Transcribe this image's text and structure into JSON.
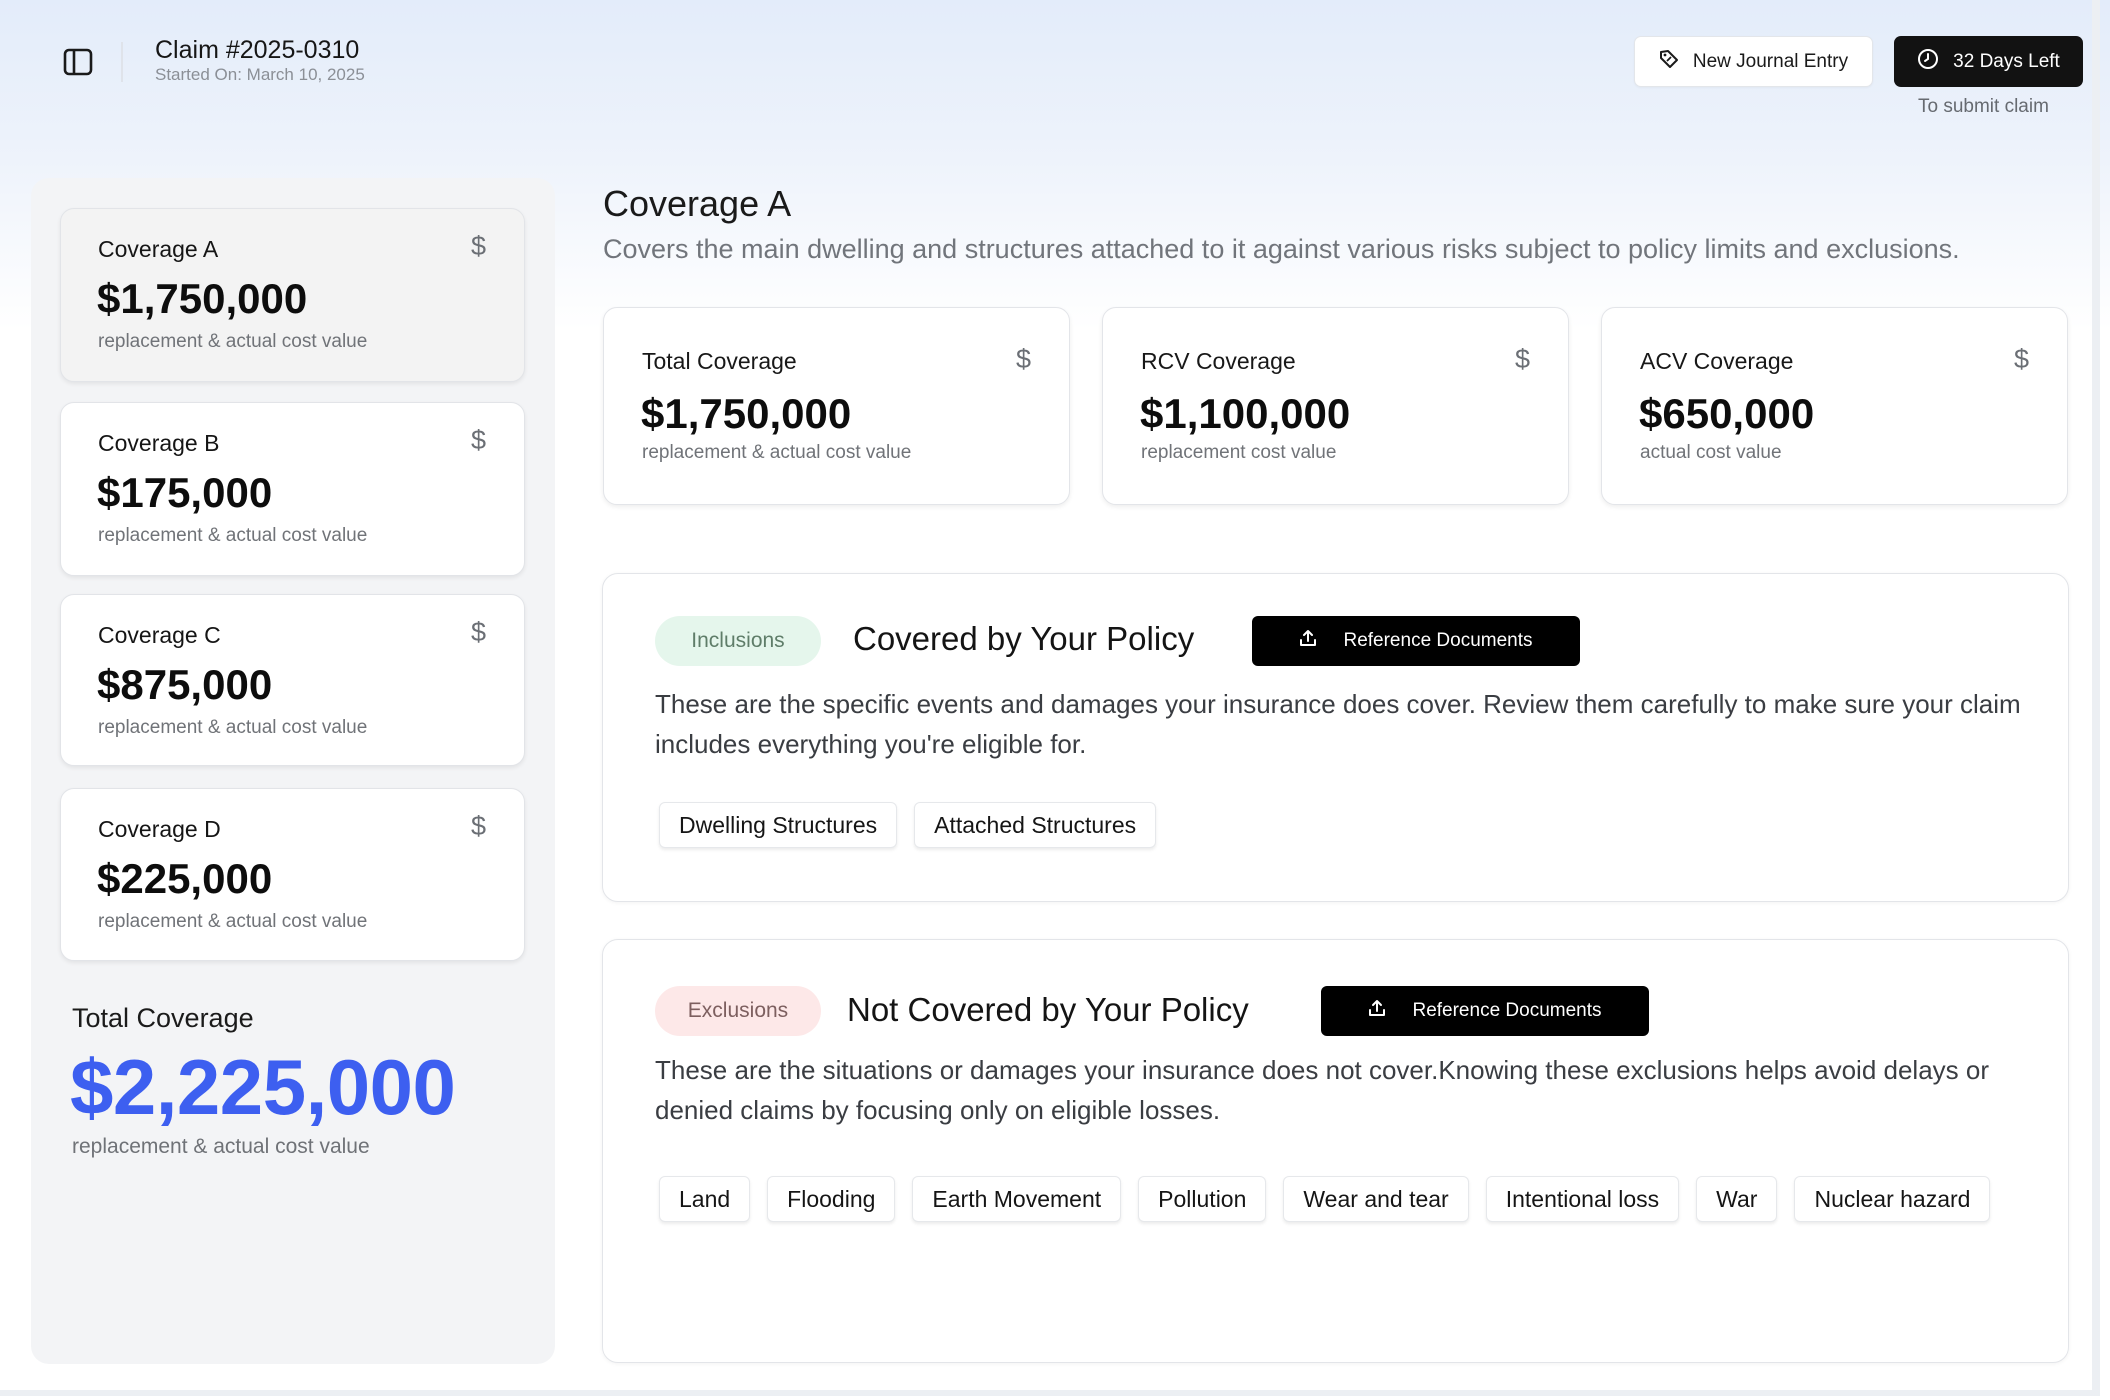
{
  "header": {
    "claim_title": "Claim #2025-0310",
    "claim_started": "Started On: March 10, 2025",
    "journal_button": "New Journal Entry",
    "days_button": "32 Days Left",
    "days_caption": "To submit claim"
  },
  "sidebar": {
    "coverages": [
      {
        "label": "Coverage A",
        "amount": "$1,750,000",
        "sub": "replacement & actual cost value",
        "selected": true
      },
      {
        "label": "Coverage B",
        "amount": "$175,000",
        "sub": "replacement & actual cost value"
      },
      {
        "label": "Coverage C",
        "amount": "$875,000",
        "sub": "replacement & actual cost value"
      },
      {
        "label": "Coverage D",
        "amount": "$225,000",
        "sub": "replacement & actual cost value"
      }
    ],
    "currency_symbol": "$",
    "total_label": "Total Coverage",
    "total_amount": "$2,225,000",
    "total_sub": "replacement & actual cost value"
  },
  "main": {
    "title": "Coverage A",
    "description": "Covers the main dwelling and structures attached to it against various risks subject to policy limits and exclusions.",
    "stats": [
      {
        "label": "Total Coverage",
        "amount": "$1,750,000",
        "sub": "replacement & actual cost value"
      },
      {
        "label": "RCV Coverage",
        "amount": "$1,100,000",
        "sub": "replacement cost value"
      },
      {
        "label": "ACV Coverage",
        "amount": "$650,000",
        "sub": "actual cost value"
      }
    ],
    "inclusions": {
      "badge": "Inclusions",
      "heading": "Covered by Your Policy",
      "ref_button": "Reference Documents",
      "description": "These are the specific events and damages your insurance does cover. Review them carefully to make sure your claim includes everything you're eligible for.",
      "tags": [
        "Dwelling Structures",
        "Attached Structures"
      ]
    },
    "exclusions": {
      "badge": "Exclusions",
      "heading": "Not Covered by Your Policy",
      "ref_button": "Reference Documents",
      "description": "These are the situations or damages your insurance does not cover.Knowing these exclusions helps avoid delays or denied claims by  focusing only on eligible losses.",
      "tags": [
        "Land",
        "Flooding",
        "Earth Movement",
        "Pollution",
        "Wear and tear",
        "Intentional loss",
        "War",
        "Nuclear hazard"
      ]
    }
  },
  "colors": {
    "accent_blue": "#3d5ff0",
    "inclusion_badge_bg": "#e5f6ec",
    "exclusion_badge_bg": "#fde8e8",
    "dark_button": "#121212"
  }
}
